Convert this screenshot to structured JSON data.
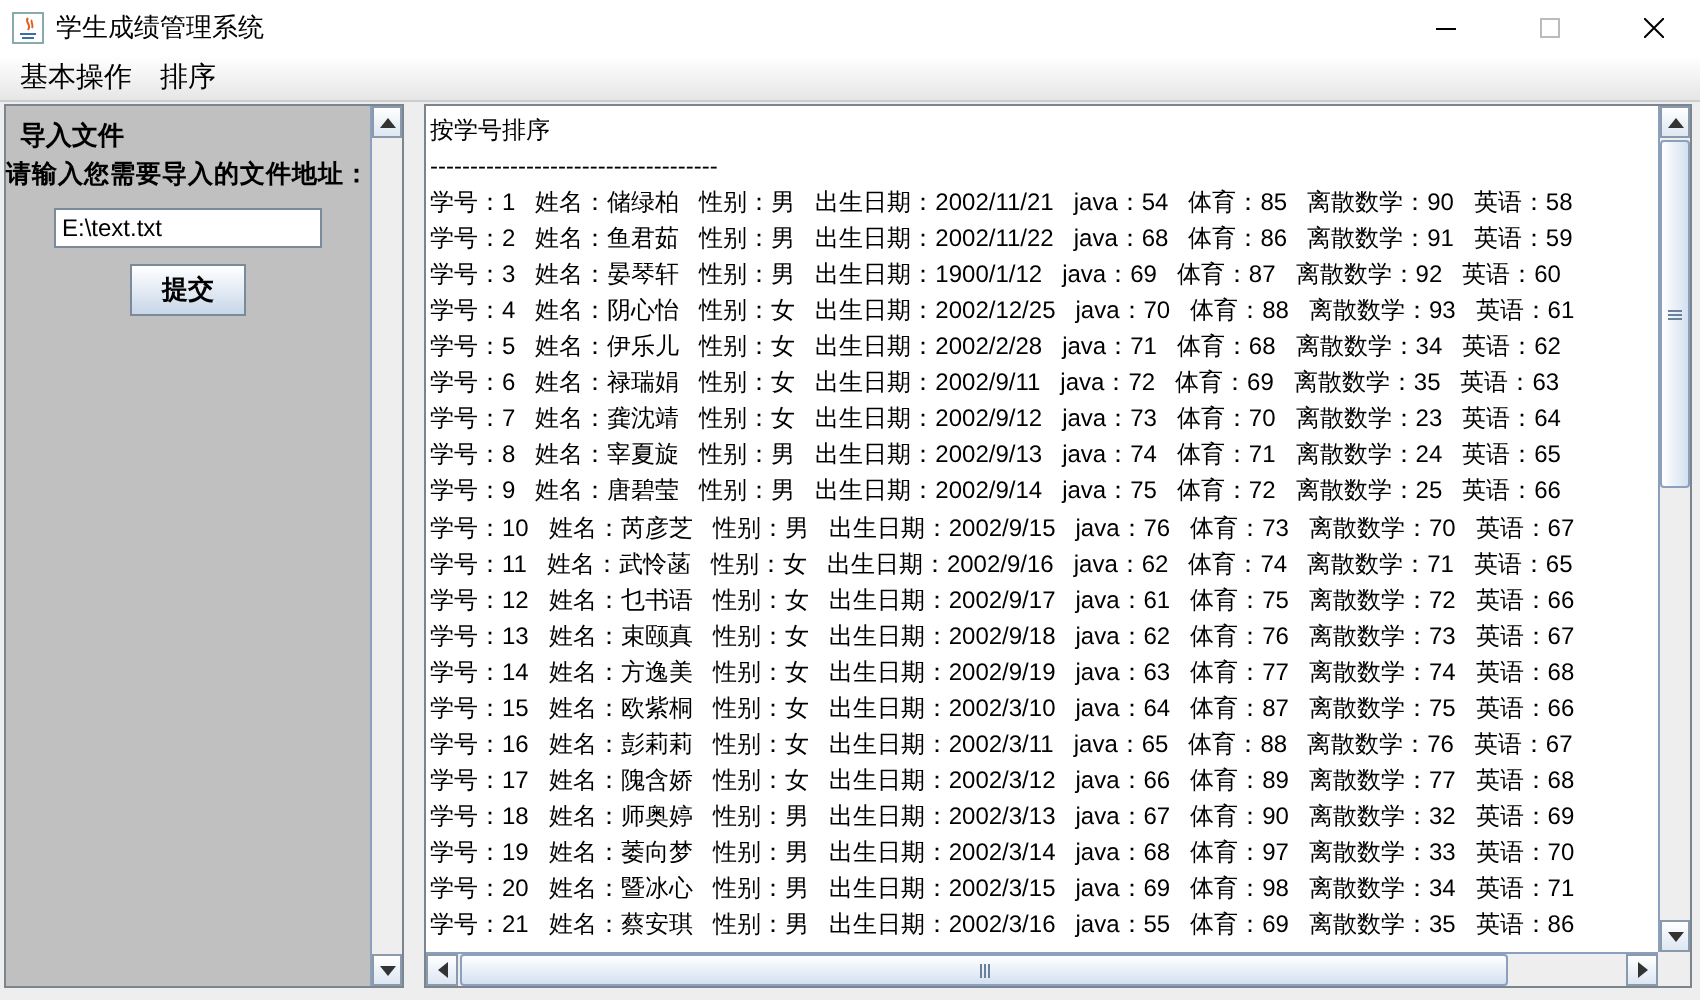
{
  "window": {
    "title": "学生成绩管理系统"
  },
  "menu": [
    {
      "label": "基本操作"
    },
    {
      "label": "排序"
    }
  ],
  "import_panel": {
    "heading": "导入文件",
    "prompt": "请输入您需要导入的文件地址：",
    "file_path": {
      "value": "E:\\text.txt"
    },
    "submit_button": "提交"
  },
  "output": {
    "heading": "按学号排序",
    "separator": "------------------------------------",
    "lines": [
      "学号：1   姓名：储绿柏   性别：男   出生日期：2002/11/21   java：54   体育：85   离散数学：90   英语：58",
      "学号：2   姓名：鱼君茹   性别：男   出生日期：2002/11/22   java：68   体育：86   离散数学：91   英语：59",
      "学号：3   姓名：晏琴轩   性别：男   出生日期：1900/1/12   java：69   体育：87   离散数学：92   英语：60",
      "学号：4   姓名：阴心怡   性别：女   出生日期：2002/12/25   java：70   体育：88   离散数学：93   英语：61",
      "学号：5   姓名：伊乐儿   性别：女   出生日期：2002/2/28   java：71   体育：68   离散数学：34   英语：62",
      "学号：6   姓名：禄瑞娟   性别：女   出生日期：2002/9/11   java：72   体育：69   离散数学：35   英语：63",
      "学号：7   姓名：龚沈靖   性别：女   出生日期：2002/9/12   java：73   体育：70   离散数学：23   英语：64",
      "学号：8   姓名：宰夏旋   性别：男   出生日期：2002/9/13   java：74   体育：71   离散数学：24   英语：65",
      "学号：9   姓名：唐碧莹   性别：男   出生日期：2002/9/14   java：75   体育：72   离散数学：25   英语：66",
      "学号：10   姓名：芮彦芝   性别：男   出生日期：2002/9/15   java：76   体育：73   离散数学：70   英语：67",
      "学号：11   姓名：武怜菡   性别：女   出生日期：2002/9/16   java：62   体育：74   离散数学：71   英语：65",
      "学号：12   姓名：乜书语   性别：女   出生日期：2002/9/17   java：61   体育：75   离散数学：72   英语：66",
      "学号：13   姓名：束颐真   性别：女   出生日期：2002/9/18   java：62   体育：76   离散数学：73   英语：67",
      "学号：14   姓名：方逸美   性别：女   出生日期：2002/9/19   java：63   体育：77   离散数学：74   英语：68",
      "学号：15   姓名：欧紫桐   性别：女   出生日期：2002/3/10   java：64   体育：87   离散数学：75   英语：66",
      "学号：16   姓名：彭莉莉   性别：女   出生日期：2002/3/11   java：65   体育：88   离散数学：76   英语：67",
      "学号：17   姓名：隗含娇   性别：女   出生日期：2002/3/12   java：66   体育：89   离散数学：77   英语：68",
      "学号：18   姓名：师奥婷   性别：男   出生日期：2002/3/13   java：67   体育：90   离散数学：32   英语：69",
      "学号：19   姓名：萎向梦   性别：男   出生日期：2002/3/14   java：68   体育：97   离散数学：33   英语：70",
      "学号：20   姓名：暨冰心   性别：男   出生日期：2002/3/15   java：69   体育：98   离散数学：34   英语：71",
      "学号：21   姓名：蔡安琪   性别：男   出生日期：2002/3/16   java：55   体育：69   离散数学：35   英语：86"
    ]
  }
}
